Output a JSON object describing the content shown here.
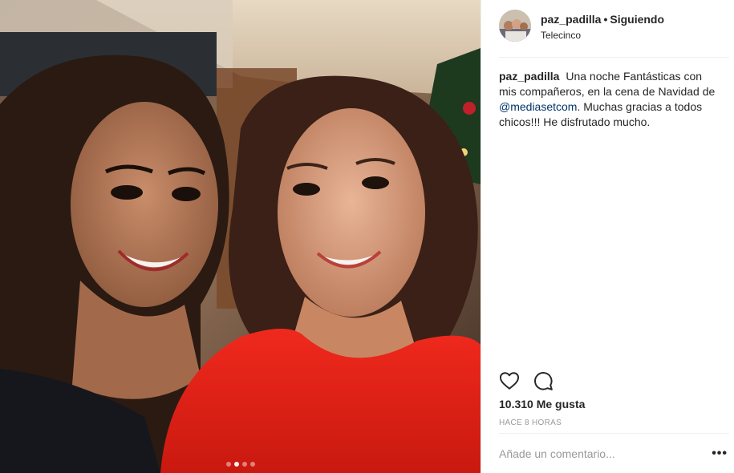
{
  "header": {
    "username": "paz_padilla",
    "separator": "•",
    "follow_status": "Siguiendo",
    "location": "Telecinco"
  },
  "caption": {
    "username": "paz_padilla",
    "text_before": "Una noche Fantásticas con mis compañeros, en la cena de Navidad de",
    "mention": "@mediasetcom",
    "text_after": ". Muchas gracias a todos chicos!!! He disfrutado mucho."
  },
  "actions": {
    "like_icon": "heart-outline-icon",
    "comment_icon": "speech-bubble-icon"
  },
  "likes": {
    "text": "10.310 Me gusta"
  },
  "timestamp": "HACE 8 HORAS",
  "comment": {
    "placeholder": "Añade un comentario...",
    "more_label": "•••"
  },
  "carousel": {
    "total": 4,
    "active_index": 1
  },
  "colors": {
    "text": "#262626",
    "muted": "#999999",
    "mention": "#003569",
    "divider": "#efefef",
    "dress_red": "#e0231b"
  }
}
